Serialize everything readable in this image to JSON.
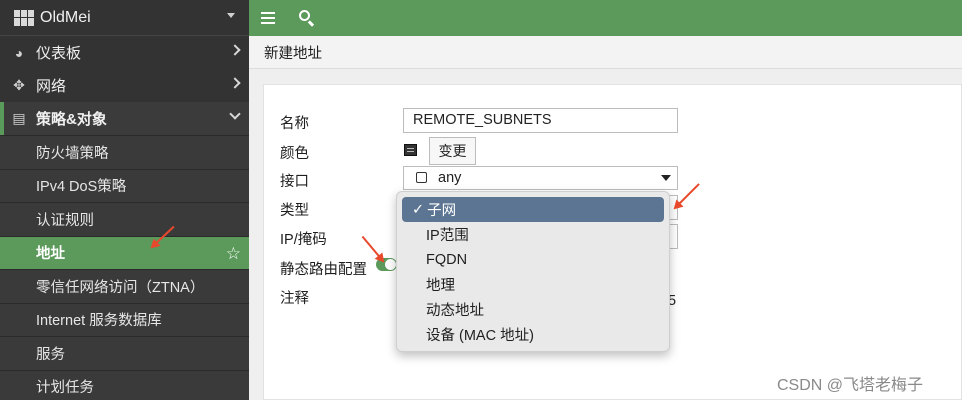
{
  "brand": {
    "name": "OldMei",
    "logo": "fortinet-grid-logo"
  },
  "topbar": {
    "menu_icon": "hamburger-icon",
    "search_icon": "search-icon"
  },
  "sidebar": {
    "items": [
      {
        "label": "仪表板",
        "icon": "dashboard-icon"
      },
      {
        "label": "网络",
        "icon": "network-move-icon"
      },
      {
        "label": "策略&对象",
        "icon": "policy-document-icon"
      }
    ],
    "subitems": [
      {
        "label": "防火墙策略"
      },
      {
        "label": "IPv4 DoS策略"
      },
      {
        "label": "认证规则"
      },
      {
        "label": "地址",
        "selected": true
      },
      {
        "label": "零信任网络访问（ZTNA）"
      },
      {
        "label": "Internet 服务数据库"
      },
      {
        "label": "服务"
      },
      {
        "label": "计划任务"
      }
    ]
  },
  "page": {
    "title": "新建地址"
  },
  "form": {
    "name_label": "名称",
    "name_value": "REMOTE_SUBNETS",
    "color_label": "颜色",
    "change_button": "变更",
    "interface_label": "接口",
    "interface_value": "any",
    "type_label": "类型",
    "ipmask_label": "IP/掩码",
    "static_route_label": "静态路由配置",
    "static_route_enabled": true,
    "comment_label": "注释",
    "comment_counter_tail": "5"
  },
  "type_dropdown": {
    "check": "✓",
    "options": [
      "子网",
      "IP范围",
      "FQDN",
      "地理",
      "动态地址",
      "设备 (MAC 地址)"
    ],
    "selected_index": 0
  },
  "colors": {
    "accent_green": "#5b9a5b",
    "sidebar_bg": "#333333",
    "dropdown_selected": "#5c7592",
    "arrow_red": "#e8492c"
  },
  "watermark": "CSDN @飞塔老梅子"
}
